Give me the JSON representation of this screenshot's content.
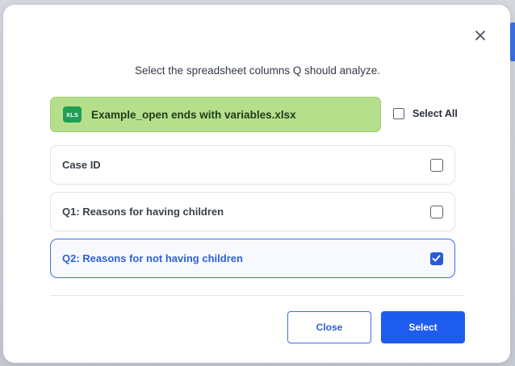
{
  "dialog": {
    "instruction": "Select the spreadsheet columns Q should analyze.",
    "close_icon": "close-icon"
  },
  "file": {
    "badge": "XLS",
    "name": "Example_open ends with variables.xlsx",
    "badge_color": "#1f9e55",
    "banner_color": "#b6df8c"
  },
  "select_all": {
    "label": "Select All",
    "checked": false
  },
  "columns": [
    {
      "label": "Case ID",
      "checked": false
    },
    {
      "label": "Q1: Reasons for having children",
      "checked": false
    },
    {
      "label": "Q2: Reasons for not having children",
      "checked": true
    }
  ],
  "buttons": {
    "close_label": "Close",
    "select_label": "Select"
  },
  "colors": {
    "accent": "#1e5cf0",
    "selected_text": "#2e5fd6"
  }
}
